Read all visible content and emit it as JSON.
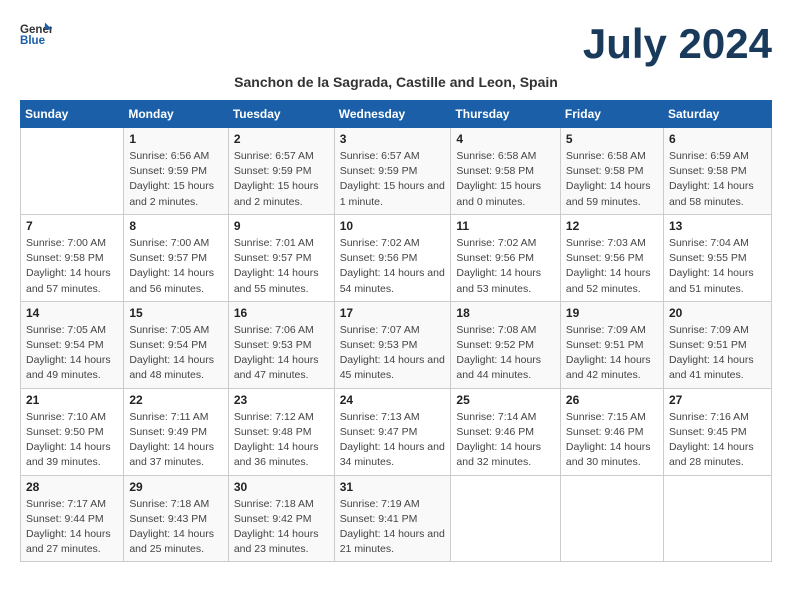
{
  "logo": {
    "general": "General",
    "blue": "Blue"
  },
  "title": "July 2024",
  "subtitle": "Sanchon de la Sagrada, Castille and Leon, Spain",
  "days_of_week": [
    "Sunday",
    "Monday",
    "Tuesday",
    "Wednesday",
    "Thursday",
    "Friday",
    "Saturday"
  ],
  "weeks": [
    [
      {
        "day": "",
        "sunrise": "",
        "sunset": "",
        "daylight": ""
      },
      {
        "day": "1",
        "sunrise": "Sunrise: 6:56 AM",
        "sunset": "Sunset: 9:59 PM",
        "daylight": "Daylight: 15 hours and 2 minutes."
      },
      {
        "day": "2",
        "sunrise": "Sunrise: 6:57 AM",
        "sunset": "Sunset: 9:59 PM",
        "daylight": "Daylight: 15 hours and 2 minutes."
      },
      {
        "day": "3",
        "sunrise": "Sunrise: 6:57 AM",
        "sunset": "Sunset: 9:59 PM",
        "daylight": "Daylight: 15 hours and 1 minute."
      },
      {
        "day": "4",
        "sunrise": "Sunrise: 6:58 AM",
        "sunset": "Sunset: 9:58 PM",
        "daylight": "Daylight: 15 hours and 0 minutes."
      },
      {
        "day": "5",
        "sunrise": "Sunrise: 6:58 AM",
        "sunset": "Sunset: 9:58 PM",
        "daylight": "Daylight: 14 hours and 59 minutes."
      },
      {
        "day": "6",
        "sunrise": "Sunrise: 6:59 AM",
        "sunset": "Sunset: 9:58 PM",
        "daylight": "Daylight: 14 hours and 58 minutes."
      }
    ],
    [
      {
        "day": "7",
        "sunrise": "Sunrise: 7:00 AM",
        "sunset": "Sunset: 9:58 PM",
        "daylight": "Daylight: 14 hours and 57 minutes."
      },
      {
        "day": "8",
        "sunrise": "Sunrise: 7:00 AM",
        "sunset": "Sunset: 9:57 PM",
        "daylight": "Daylight: 14 hours and 56 minutes."
      },
      {
        "day": "9",
        "sunrise": "Sunrise: 7:01 AM",
        "sunset": "Sunset: 9:57 PM",
        "daylight": "Daylight: 14 hours and 55 minutes."
      },
      {
        "day": "10",
        "sunrise": "Sunrise: 7:02 AM",
        "sunset": "Sunset: 9:56 PM",
        "daylight": "Daylight: 14 hours and 54 minutes."
      },
      {
        "day": "11",
        "sunrise": "Sunrise: 7:02 AM",
        "sunset": "Sunset: 9:56 PM",
        "daylight": "Daylight: 14 hours and 53 minutes."
      },
      {
        "day": "12",
        "sunrise": "Sunrise: 7:03 AM",
        "sunset": "Sunset: 9:56 PM",
        "daylight": "Daylight: 14 hours and 52 minutes."
      },
      {
        "day": "13",
        "sunrise": "Sunrise: 7:04 AM",
        "sunset": "Sunset: 9:55 PM",
        "daylight": "Daylight: 14 hours and 51 minutes."
      }
    ],
    [
      {
        "day": "14",
        "sunrise": "Sunrise: 7:05 AM",
        "sunset": "Sunset: 9:54 PM",
        "daylight": "Daylight: 14 hours and 49 minutes."
      },
      {
        "day": "15",
        "sunrise": "Sunrise: 7:05 AM",
        "sunset": "Sunset: 9:54 PM",
        "daylight": "Daylight: 14 hours and 48 minutes."
      },
      {
        "day": "16",
        "sunrise": "Sunrise: 7:06 AM",
        "sunset": "Sunset: 9:53 PM",
        "daylight": "Daylight: 14 hours and 47 minutes."
      },
      {
        "day": "17",
        "sunrise": "Sunrise: 7:07 AM",
        "sunset": "Sunset: 9:53 PM",
        "daylight": "Daylight: 14 hours and 45 minutes."
      },
      {
        "day": "18",
        "sunrise": "Sunrise: 7:08 AM",
        "sunset": "Sunset: 9:52 PM",
        "daylight": "Daylight: 14 hours and 44 minutes."
      },
      {
        "day": "19",
        "sunrise": "Sunrise: 7:09 AM",
        "sunset": "Sunset: 9:51 PM",
        "daylight": "Daylight: 14 hours and 42 minutes."
      },
      {
        "day": "20",
        "sunrise": "Sunrise: 7:09 AM",
        "sunset": "Sunset: 9:51 PM",
        "daylight": "Daylight: 14 hours and 41 minutes."
      }
    ],
    [
      {
        "day": "21",
        "sunrise": "Sunrise: 7:10 AM",
        "sunset": "Sunset: 9:50 PM",
        "daylight": "Daylight: 14 hours and 39 minutes."
      },
      {
        "day": "22",
        "sunrise": "Sunrise: 7:11 AM",
        "sunset": "Sunset: 9:49 PM",
        "daylight": "Daylight: 14 hours and 37 minutes."
      },
      {
        "day": "23",
        "sunrise": "Sunrise: 7:12 AM",
        "sunset": "Sunset: 9:48 PM",
        "daylight": "Daylight: 14 hours and 36 minutes."
      },
      {
        "day": "24",
        "sunrise": "Sunrise: 7:13 AM",
        "sunset": "Sunset: 9:47 PM",
        "daylight": "Daylight: 14 hours and 34 minutes."
      },
      {
        "day": "25",
        "sunrise": "Sunrise: 7:14 AM",
        "sunset": "Sunset: 9:46 PM",
        "daylight": "Daylight: 14 hours and 32 minutes."
      },
      {
        "day": "26",
        "sunrise": "Sunrise: 7:15 AM",
        "sunset": "Sunset: 9:46 PM",
        "daylight": "Daylight: 14 hours and 30 minutes."
      },
      {
        "day": "27",
        "sunrise": "Sunrise: 7:16 AM",
        "sunset": "Sunset: 9:45 PM",
        "daylight": "Daylight: 14 hours and 28 minutes."
      }
    ],
    [
      {
        "day": "28",
        "sunrise": "Sunrise: 7:17 AM",
        "sunset": "Sunset: 9:44 PM",
        "daylight": "Daylight: 14 hours and 27 minutes."
      },
      {
        "day": "29",
        "sunrise": "Sunrise: 7:18 AM",
        "sunset": "Sunset: 9:43 PM",
        "daylight": "Daylight: 14 hours and 25 minutes."
      },
      {
        "day": "30",
        "sunrise": "Sunrise: 7:18 AM",
        "sunset": "Sunset: 9:42 PM",
        "daylight": "Daylight: 14 hours and 23 minutes."
      },
      {
        "day": "31",
        "sunrise": "Sunrise: 7:19 AM",
        "sunset": "Sunset: 9:41 PM",
        "daylight": "Daylight: 14 hours and 21 minutes."
      },
      {
        "day": "",
        "sunrise": "",
        "sunset": "",
        "daylight": ""
      },
      {
        "day": "",
        "sunrise": "",
        "sunset": "",
        "daylight": ""
      },
      {
        "day": "",
        "sunrise": "",
        "sunset": "",
        "daylight": ""
      }
    ]
  ]
}
